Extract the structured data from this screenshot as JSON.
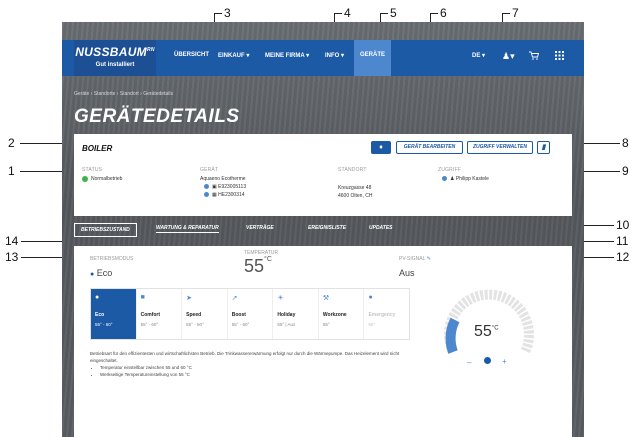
{
  "callouts": [
    "1",
    "2",
    "3",
    "4",
    "5",
    "6",
    "7",
    "8",
    "9",
    "10",
    "11",
    "12",
    "13",
    "14"
  ],
  "header": {
    "brand": "NUSSBAUM",
    "brand_suffix": "RN",
    "tagline": "Gut installiert",
    "nav": [
      "ÜBERSICHT",
      "EINKAUF ▾",
      "MEINE FIRMA ▾",
      "INFO ▾",
      "GERÄTE"
    ],
    "lang": "DE ▾",
    "user_icon": "user-icon",
    "cart_icon": "cart-icon",
    "grid_icon": "grid-icon"
  },
  "breadcrumb": "Geräte › Standorte › Standort › Gerätedetails",
  "page_title": "GERÄTEDETAILS",
  "device": {
    "name": "BOILER",
    "bell_icon": "bell-icon",
    "edit_button": "GERÄT BEARBEITEN",
    "access_button": "ZUGRIFF VERWALTEN",
    "delete_icon": "trash-icon",
    "status_label": "STATUS",
    "status_value": "Normalbetrieb",
    "device_label": "GERÄT",
    "device_model": "Aquaeno Ecotherme",
    "serial_1": "E923005113",
    "serial_2": "HE2300314",
    "location_label": "STANDORT",
    "location_line1": "Kreuzgasse 48",
    "location_line2": "4600 Olten, CH",
    "access_label": "ZUGRIFF",
    "access_value": "Philipp Kastele"
  },
  "tabs": [
    "BETRIEBSZUSTAND",
    "WARTUNG & REPARATUR",
    "VERTRÄGE",
    "EREIGNISLISTE",
    "UPDATES"
  ],
  "panel": {
    "mode_label": "BETRIEBSMODUS",
    "mode_value": "Eco",
    "temp_label": "TEMPERATUR",
    "temp_value": "55",
    "temp_unit": "°C",
    "pv_label": "PV-SIGNAL",
    "pv_value": "Aus",
    "modes": [
      {
        "name": "Eco",
        "range": "55° - 60°",
        "icon": "leaf-icon"
      },
      {
        "name": "Comfort",
        "range": "55° - 60°",
        "icon": "sofa-icon"
      },
      {
        "name": "Speed",
        "range": "55° - 60°",
        "icon": "speed-icon"
      },
      {
        "name": "Boost",
        "range": "55° - 60°",
        "icon": "rocket-icon"
      },
      {
        "name": "Holiday",
        "range": "55° | Aus",
        "icon": "holiday-icon"
      },
      {
        "name": "Workzone",
        "range": "55°",
        "icon": "wrench-icon"
      },
      {
        "name": "Emergency",
        "range": "55°",
        "icon": "emergency-icon"
      }
    ],
    "description": "Betriebsart für den effizientesten und wirtschaftlichsten Betrieb. Die Trinkwassererwärmung erfolgt nur durch die Wärmepumpe. Das Heizelement wird nicht eingeschaltet.",
    "bullets": [
      "Temperatur einstellbar zwischen 55 und 60 °C",
      "Werkseitige Temperatureinstellung von 55 °C"
    ],
    "gauge_value": "55",
    "gauge_unit": "°C",
    "gauge_minus": "–",
    "gauge_plus": "+"
  },
  "colors": {
    "primary": "#1d5aa6",
    "accent": "#4d88cf",
    "ok": "#3fb348"
  }
}
